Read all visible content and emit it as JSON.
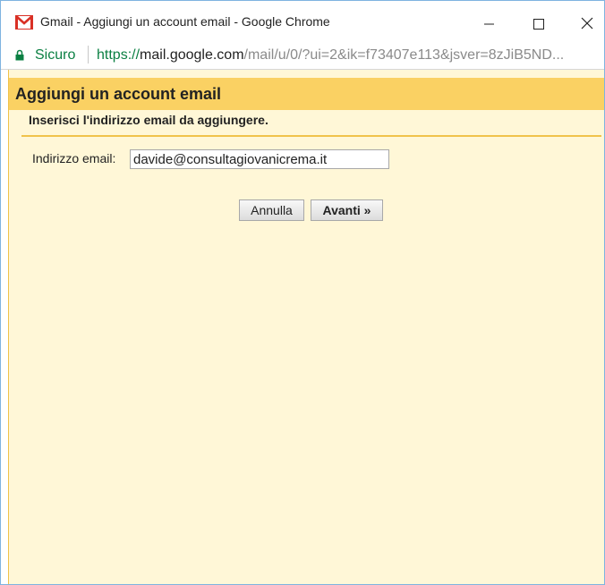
{
  "window": {
    "title": "Gmail - Aggiungi un account email - Google Chrome",
    "icon": "gmail-icon",
    "controls": [
      "minimize-icon",
      "maximize-icon",
      "close-icon"
    ]
  },
  "addressbar": {
    "security_label": "Sicuro",
    "url_scheme": "https://",
    "url_host": "mail.google.com",
    "url_path": "/mail/u/0/?ui=2&ik=f73407e113&jsver=8zJiB5ND..."
  },
  "dialog": {
    "title": "Aggiungi un account email",
    "instruction": "Inserisci l'indirizzo email da aggiungere.",
    "email_label": "Indirizzo email:",
    "email_value": "davide@consultagiovanicrema.it",
    "cancel_label": "Annulla",
    "next_label": "Avanti »"
  },
  "colors": {
    "header_bg": "#fad163",
    "content_bg": "#fff7d7",
    "secure_green": "#0b8043",
    "gmail_red": "#d93025"
  }
}
